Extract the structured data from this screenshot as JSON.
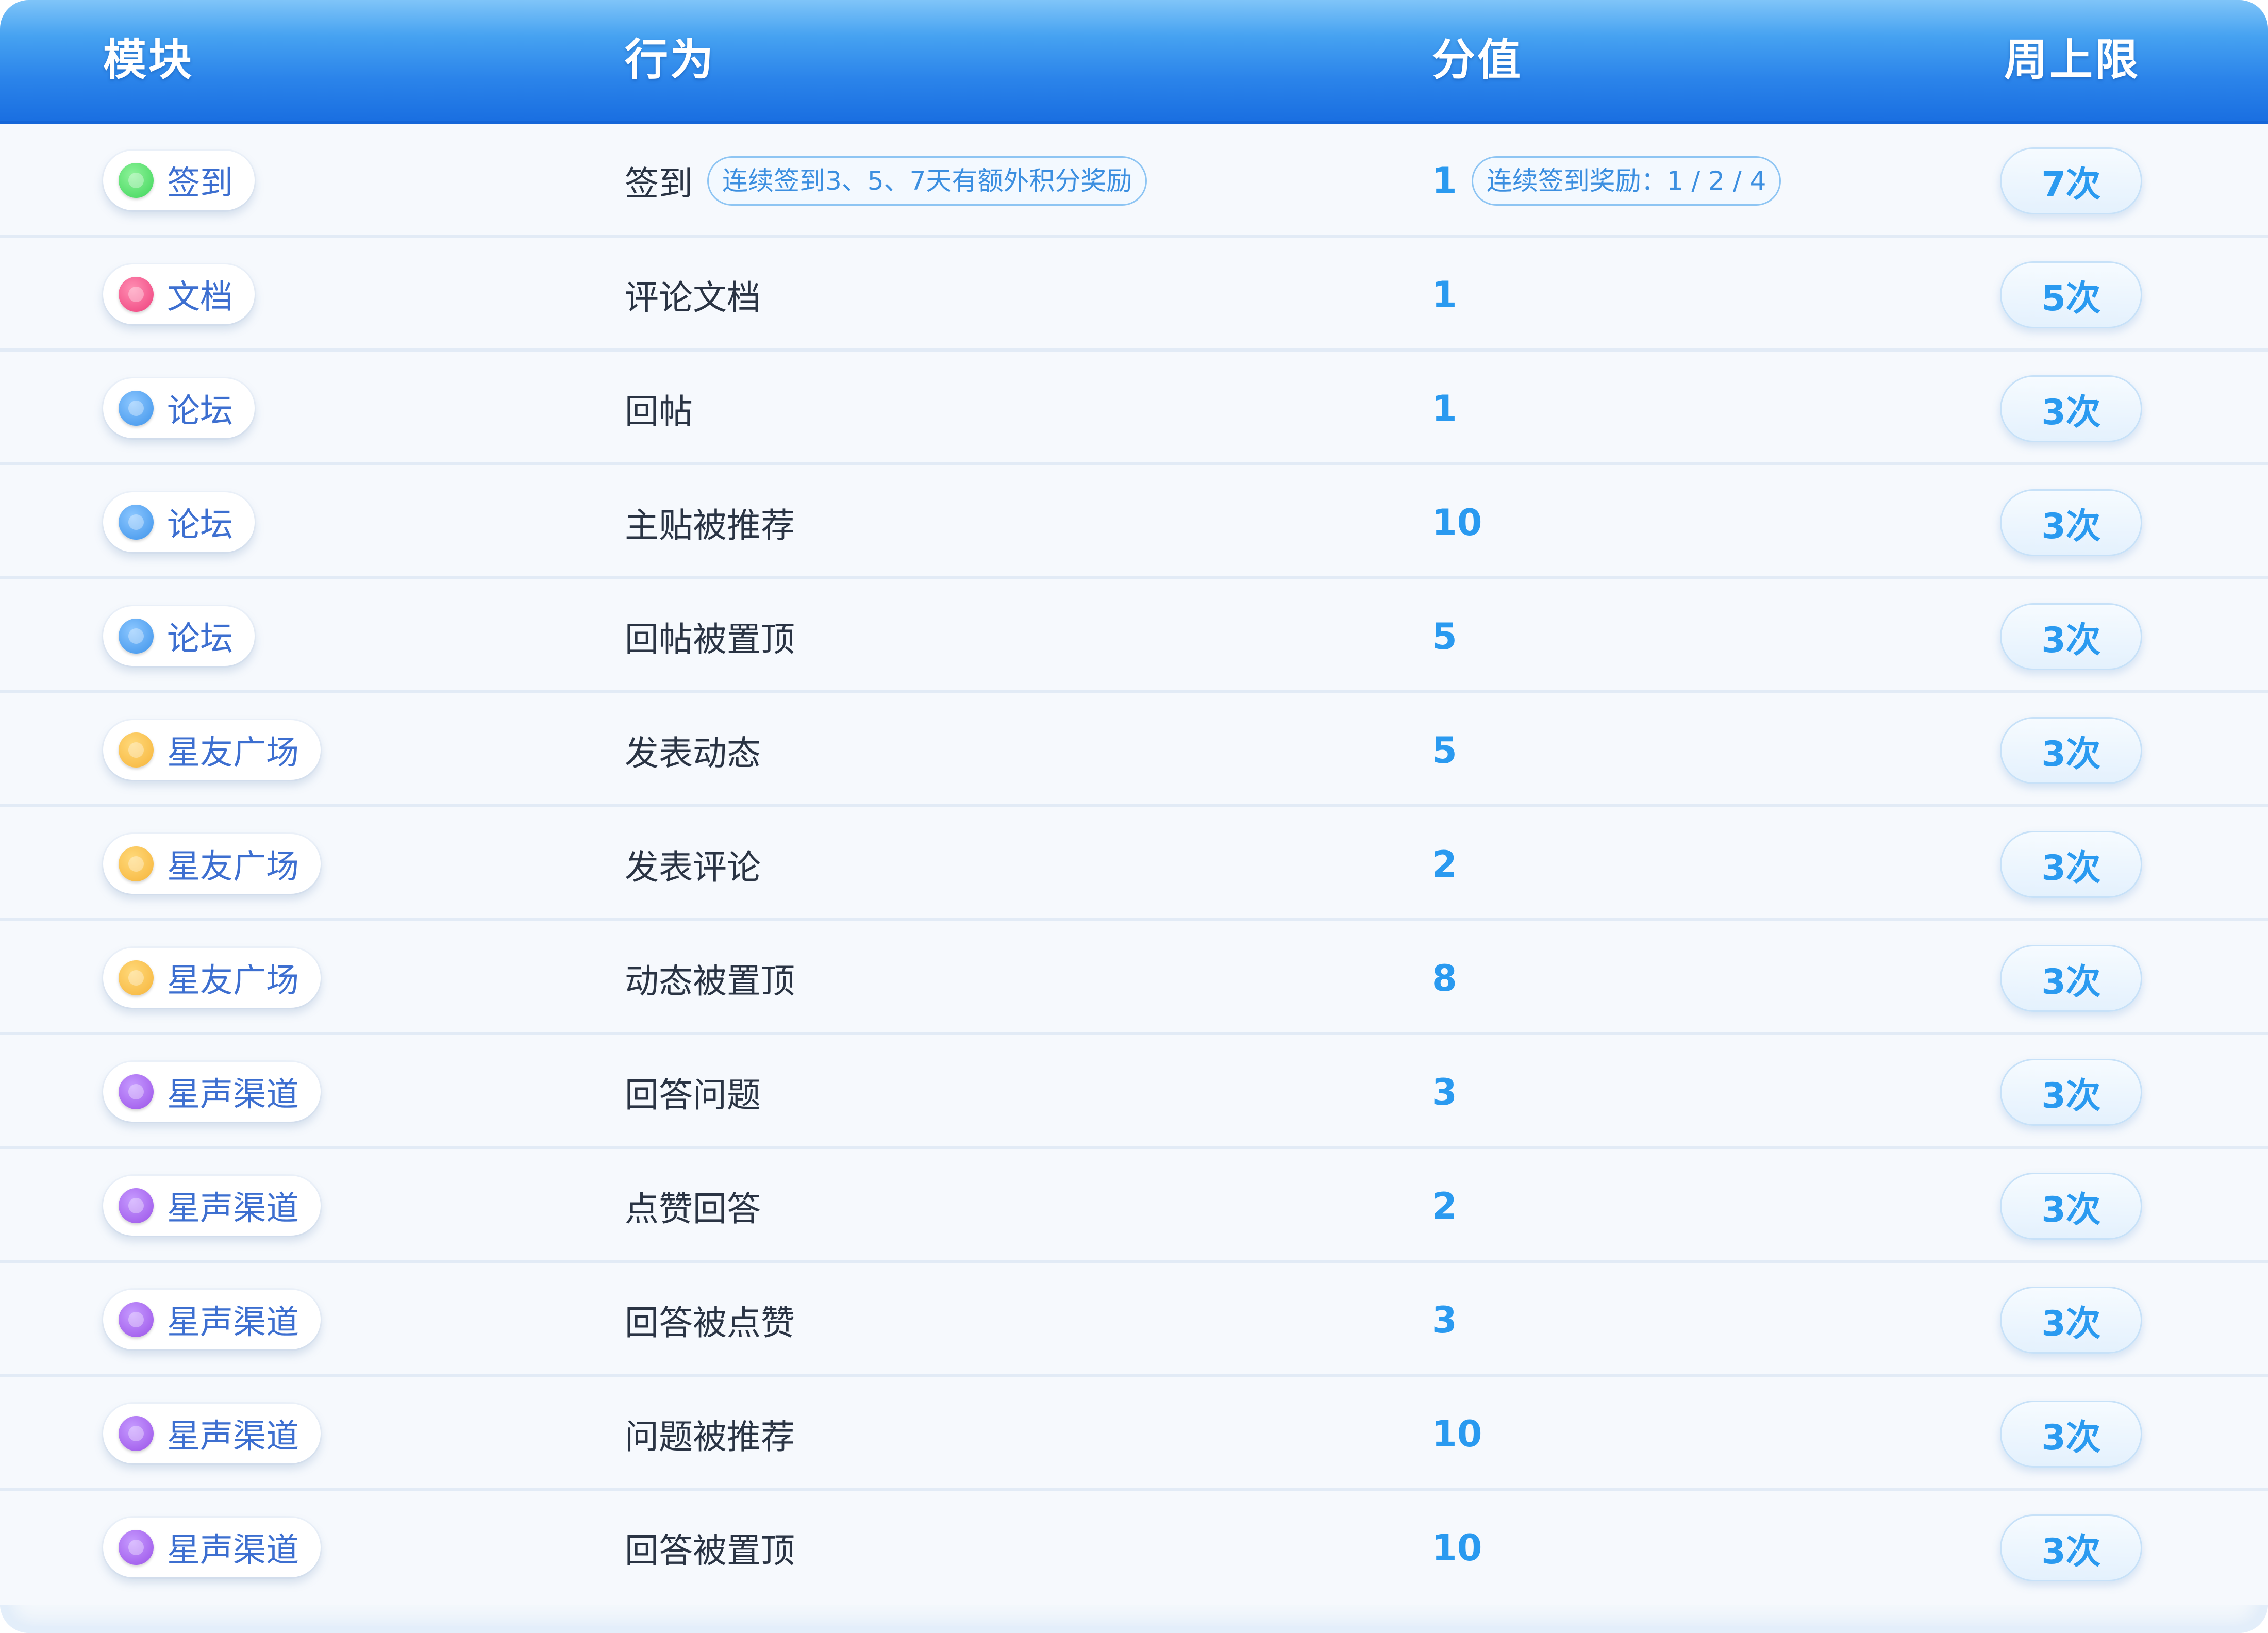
{
  "header": {
    "module": "模块",
    "action": "行为",
    "score": "分值",
    "limit": "周上限"
  },
  "rows": [
    {
      "module": "签到",
      "color": "#3fd55a",
      "action": "签到",
      "action_note": "连续签到3、5、7天有额外积分奖励",
      "score": "1",
      "score_note": "连续签到奖励：1 / 2 / 4",
      "limit": "7次"
    },
    {
      "module": "文档",
      "color": "#ee3f7c",
      "action": "评论文档",
      "score": "1",
      "limit": "5次"
    },
    {
      "module": "论坛",
      "color": "#3e93ea",
      "action": "回帖",
      "score": "1",
      "limit": "3次"
    },
    {
      "module": "论坛",
      "color": "#3e93ea",
      "action": "主贴被推荐",
      "score": "10",
      "limit": "3次"
    },
    {
      "module": "论坛",
      "color": "#3e93ea",
      "action": "回帖被置顶",
      "score": "5",
      "limit": "3次"
    },
    {
      "module": "星友广场",
      "color": "#f6b43a",
      "action": "发表动态",
      "score": "5",
      "limit": "3次"
    },
    {
      "module": "星友广场",
      "color": "#f6b43a",
      "action": "发表评论",
      "score": "2",
      "limit": "3次"
    },
    {
      "module": "星友广场",
      "color": "#f6b43a",
      "action": "动态被置顶",
      "score": "8",
      "limit": "3次"
    },
    {
      "module": "星声渠道",
      "color": "#9b52e8",
      "action": "回答问题",
      "score": "3",
      "limit": "3次"
    },
    {
      "module": "星声渠道",
      "color": "#9b52e8",
      "action": "点赞回答",
      "score": "2",
      "limit": "3次"
    },
    {
      "module": "星声渠道",
      "color": "#9b52e8",
      "action": "回答被点赞",
      "score": "3",
      "limit": "3次"
    },
    {
      "module": "星声渠道",
      "color": "#9b52e8",
      "action": "问题被推荐",
      "score": "10",
      "limit": "3次"
    },
    {
      "module": "星声渠道",
      "color": "#9b52e8",
      "action": "回答被置顶",
      "score": "10",
      "limit": "3次"
    }
  ]
}
